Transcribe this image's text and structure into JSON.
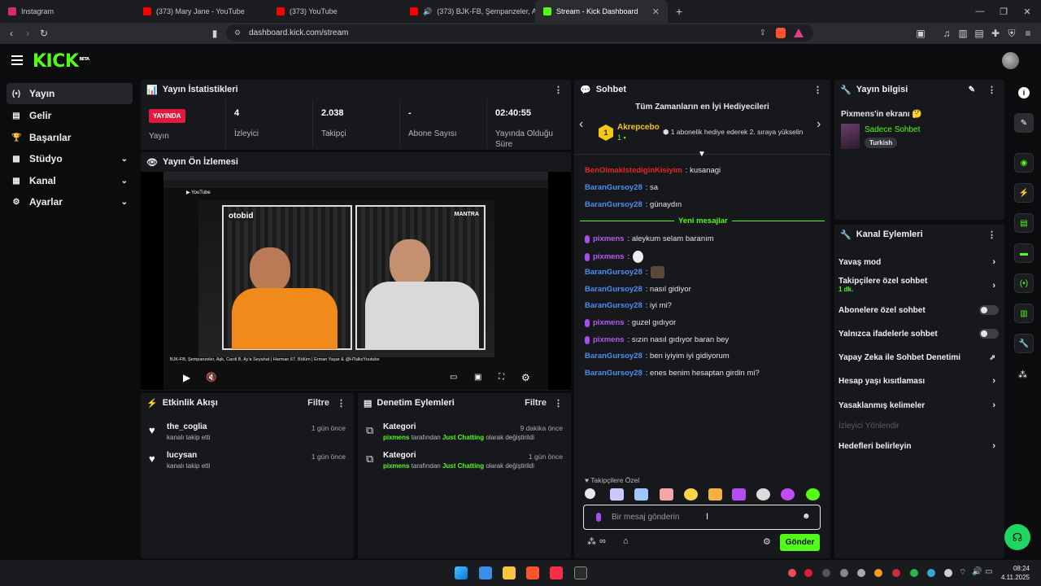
{
  "browser": {
    "tabs": [
      {
        "title": "Instagram",
        "color": "#d62976"
      },
      {
        "title": "(373) Mary Jane - YouTube",
        "color": "#ff0000"
      },
      {
        "title": "(373) YouTube",
        "color": "#ff0000"
      },
      {
        "title": "(373) BJK-FB, Şempanzeler, Aşk, C",
        "color": "#ff0000"
      },
      {
        "title": "Stream - Kick Dashboard",
        "color": "#53fc18"
      }
    ],
    "new_tab": "+",
    "url": "dashboard.kick.com/stream"
  },
  "nav": {
    "items": [
      {
        "label": "Yayın",
        "icon": "broadcast-icon"
      },
      {
        "label": "Gelir",
        "icon": "wallet-icon"
      },
      {
        "label": "Başarılar",
        "icon": "trophy-icon"
      },
      {
        "label": "Stüdyo",
        "icon": "studio-icon"
      },
      {
        "label": "Kanal",
        "icon": "channel-icon"
      },
      {
        "label": "Ayarlar",
        "icon": "gear-icon"
      }
    ]
  },
  "stats": {
    "title": "Yayın İstatistikleri",
    "live_badge": "YAYINDA",
    "live_label": "Yayın",
    "cells": [
      {
        "value": "4",
        "label": "İzleyici"
      },
      {
        "value": "2.038",
        "label": "Takipçi"
      },
      {
        "value": "-",
        "label": "Abone Sayısı"
      },
      {
        "value": "02:40:55",
        "label": "Yayında Olduğu Süre"
      }
    ]
  },
  "preview": {
    "title": "Yayın Ön İzlemesi",
    "video_caption": "BJK-FB, Şempanzeler, Aşk, Cardi B, Ay'a Seyahat | Harman 67. Bölüm | Erman Yaşar & @HTalksYoutube",
    "brand_left": "otobid",
    "brand_right": "MANTRA"
  },
  "activity": {
    "title": "Etkinlik Akışı",
    "filter": "Filtre",
    "items": [
      {
        "name": "the_coglia",
        "sub": "kanalı takip etti",
        "time": "1 gün önce"
      },
      {
        "name": "lucysan",
        "sub": "kanalı takip etti",
        "time": "1 gün önce"
      }
    ]
  },
  "moderation": {
    "title": "Denetim Eylemleri",
    "filter": "Filtre",
    "items": [
      {
        "title": "Kategori",
        "user": "pixmens",
        "mid": "tarafından",
        "category": "Just Chatting",
        "end": "olarak değiştirildi",
        "time": "9 dakika önce"
      },
      {
        "title": "Kategori",
        "user": "pixmens",
        "mid": "tarafından",
        "category": "Just Chatting",
        "end": "olarak değiştirildi",
        "time": "1 gün önce"
      }
    ]
  },
  "chat": {
    "title": "Sohbet",
    "gifters_title": "Tüm Zamanların en İyi Hediyecileri",
    "top_gifter": "Akrepcebo",
    "top_gifter_rank": "1",
    "top_gifter_count": "1",
    "gifter_hint": "1 abonelik hediye ederek 2. sıraya yükselin",
    "new_messages": "Yeni mesajlar",
    "messages": [
      {
        "user": "BenOlmakIstediginKisiyim",
        "text": ": kusanagi",
        "color": "red",
        "mic": false
      },
      {
        "user": "BaranGursoy28",
        "text": ": sa",
        "color": "blue",
        "mic": false
      },
      {
        "user": "BaranGursoy28",
        "text": ": günaydın",
        "color": "blue",
        "mic": false
      },
      {
        "user": "pixmens",
        "text": ": aleykum selam baranım",
        "color": "purple",
        "mic": true
      },
      {
        "user": "pixmens",
        "text": ":",
        "color": "purple",
        "mic": true,
        "emote": true
      },
      {
        "user": "BaranGursoy28",
        "text": ":",
        "color": "blue",
        "mic": false,
        "emote": true
      },
      {
        "user": "BaranGursoy28",
        "text": ": nasıl gidiyor",
        "color": "blue",
        "mic": false
      },
      {
        "user": "BaranGursoy28",
        "text": ": iyi mi?",
        "color": "blue",
        "mic": false
      },
      {
        "user": "pixmens",
        "text": ": guzel gıdıyor",
        "color": "purple",
        "mic": true
      },
      {
        "user": "pixmens",
        "text": ": sızın nasıl gıdıyor baran bey",
        "color": "purple",
        "mic": true
      },
      {
        "user": "BaranGursoy28",
        "text": ": ben iyiyim iyi gidiyorum",
        "color": "blue",
        "mic": false
      },
      {
        "user": "BaranGursoy28",
        "text": ": enes benim hesaptan girdin mi?",
        "color": "blue",
        "mic": false
      }
    ],
    "followers_only": "Takipçilere Özel",
    "emote_colors": [
      "#e8e8e8",
      "#c9c9ff",
      "#9fc7ff",
      "#f4a6a6",
      "#f7d64a",
      "#f5b042",
      "#b44cf5",
      "#dcdcdc",
      "#c04cf5",
      "#53fc18"
    ],
    "input_placeholder": "Bir mesaj gönderin",
    "send_label": "Gönder"
  },
  "stream_info": {
    "title": "Yayın bilgisi",
    "screen_title": "Pixmens'in ekranı 🤔",
    "category": "Sadece Sohbet",
    "tag": "Turkish"
  },
  "channel_actions": {
    "title": "Kanal Eylemleri",
    "slow_mode": "Yavaş mod",
    "followers_chat": "Takipçilere özel sohbet",
    "followers_chat_sub": "1 dk.",
    "subs_chat": "Abonelere özel sohbet",
    "emotes_chat": "Yalnızca ifadelerle sohbet",
    "ai_moderation": "Yapay Zeka ile Sohbet Denetimi",
    "account_age": "Hesap yaşı kısıtlaması",
    "banned_words": "Yasaklanmış kelimeler",
    "redirect_viewers": "İzleyici Yönlendir",
    "set_goals": "Hedefleri belirleyin"
  },
  "taskbar": {
    "time": "08:24",
    "date": "4.11.2025"
  }
}
